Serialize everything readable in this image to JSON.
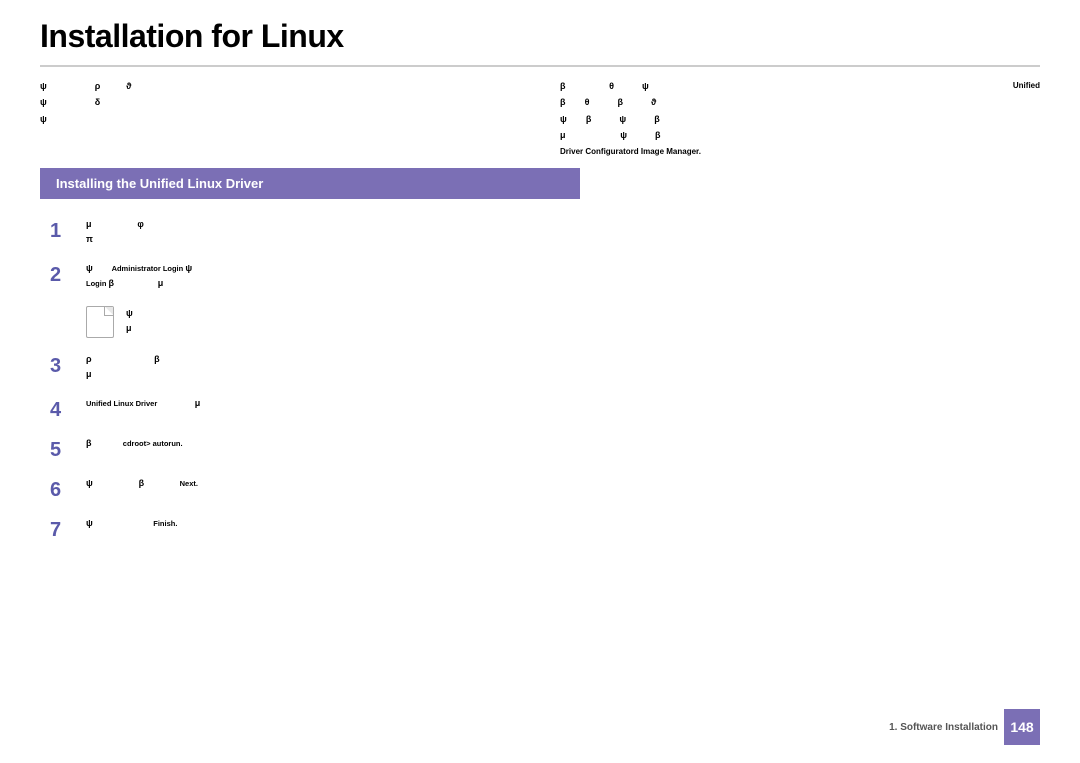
{
  "page": {
    "title": "Installation for Linux",
    "section_header": "Installing the Unified Linux Driver"
  },
  "intro": {
    "left_lines": [
      "ψ                    ρ             ϑ",
      "ψ                    δ",
      "ψ"
    ],
    "right_lines": [
      "β                              θ              ψ",
      "β",
      "ψ",
      "ψ                    β             β             ϑ"
    ],
    "driver_configurator_label": "Driver Configuratord   Image Manager.",
    "unified_label": "Unified"
  },
  "steps": [
    {
      "number": "1",
      "lines": [
        "μ                              φ",
        "π"
      ]
    },
    {
      "number": "2",
      "lines": [
        "ψ       Administrator Loginψ",
        "Loginβ                    μ"
      ]
    },
    {
      "number": "3",
      "lines": [
        "ρ                              β",
        "μ"
      ]
    },
    {
      "number": "4",
      "lines": [
        "Unified Linux Driver                    μ"
      ]
    },
    {
      "number": "5",
      "lines": [
        "β              cdroot>  autorun."
      ]
    },
    {
      "number": "6",
      "lines": [
        "ψ                         β                    Next."
      ]
    },
    {
      "number": "7",
      "lines": [
        "ψ                                   Finish."
      ]
    }
  ],
  "note": {
    "lines": [
      "ψ",
      "μ"
    ]
  },
  "footer": {
    "section_label": "1.  Software Installation",
    "page_number": "148"
  }
}
